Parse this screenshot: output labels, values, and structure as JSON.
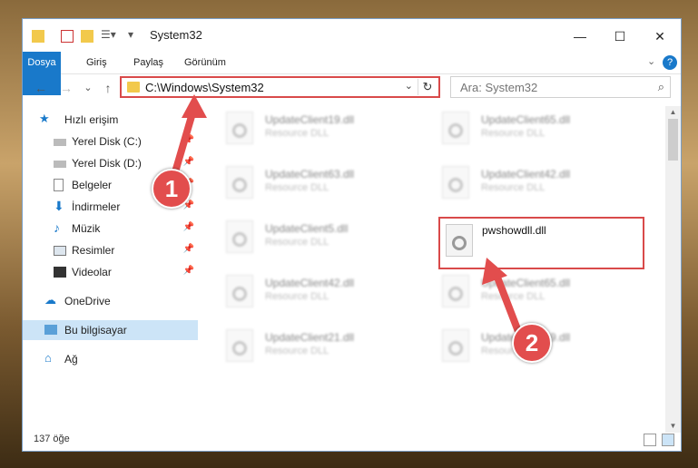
{
  "window": {
    "title": "System32",
    "controls": {
      "minimize": "—",
      "maximize": "☐",
      "close": "✕"
    }
  },
  "ribbon": {
    "tabs": [
      "Dosya",
      "Giriş",
      "Paylaş",
      "Görünüm"
    ],
    "accent": "#1979ca",
    "help": "?"
  },
  "navigation": {
    "back": "←",
    "forward": "→",
    "recent": "⌄",
    "up": "↑",
    "address": "C:\\Windows\\System32",
    "search_placeholder": "Ara: System32"
  },
  "sidebar": {
    "items": [
      {
        "label": "Hızlı erişim",
        "icon": "star-icon",
        "pinned": false
      },
      {
        "label": "Yerel Disk (C:)",
        "icon": "drive-icon",
        "pinned": true
      },
      {
        "label": "Yerel Disk (D:)",
        "icon": "drive-icon",
        "pinned": true
      },
      {
        "label": "Belgeler",
        "icon": "document-icon",
        "pinned": true
      },
      {
        "label": "İndirmeler",
        "icon": "download-icon",
        "pinned": true
      },
      {
        "label": "Müzik",
        "icon": "music-icon",
        "pinned": true
      },
      {
        "label": "Resimler",
        "icon": "picture-icon",
        "pinned": true
      },
      {
        "label": "Videolar",
        "icon": "video-icon",
        "pinned": true
      },
      {
        "label": "OneDrive",
        "icon": "cloud-icon",
        "pinned": false
      },
      {
        "label": "Bu bilgisayar",
        "icon": "computer-icon",
        "pinned": false,
        "selected": true
      },
      {
        "label": "Ağ",
        "icon": "network-icon",
        "pinned": false
      }
    ]
  },
  "files": [
    {
      "name": "UpdateClient19.dll",
      "type": "Resource DLL"
    },
    {
      "name": "UpdateClient65.dll",
      "type": "Resource DLL"
    },
    {
      "name": "UpdateClient63.dll",
      "type": "Resource DLL"
    },
    {
      "name": "UpdateClient42.dll",
      "type": "Resource DLL"
    },
    {
      "name": "UpdateClient5.dll",
      "type": "Resource DLL"
    },
    {
      "name": "pwshowdll.dll",
      "type": "",
      "highlighted": true
    },
    {
      "name": "UpdateClient42.dll",
      "type": "Resource DLL"
    },
    {
      "name": "UpdateClient65.dll",
      "type": "Resource DLL"
    },
    {
      "name": "UpdateClient21.dll",
      "type": "Resource DLL"
    },
    {
      "name": "UpdateClient19.dll",
      "type": "Resource DLL"
    }
  ],
  "status": {
    "count": "137 öğe"
  },
  "callouts": [
    "1",
    "2"
  ],
  "highlight_color": "#d94a4a"
}
